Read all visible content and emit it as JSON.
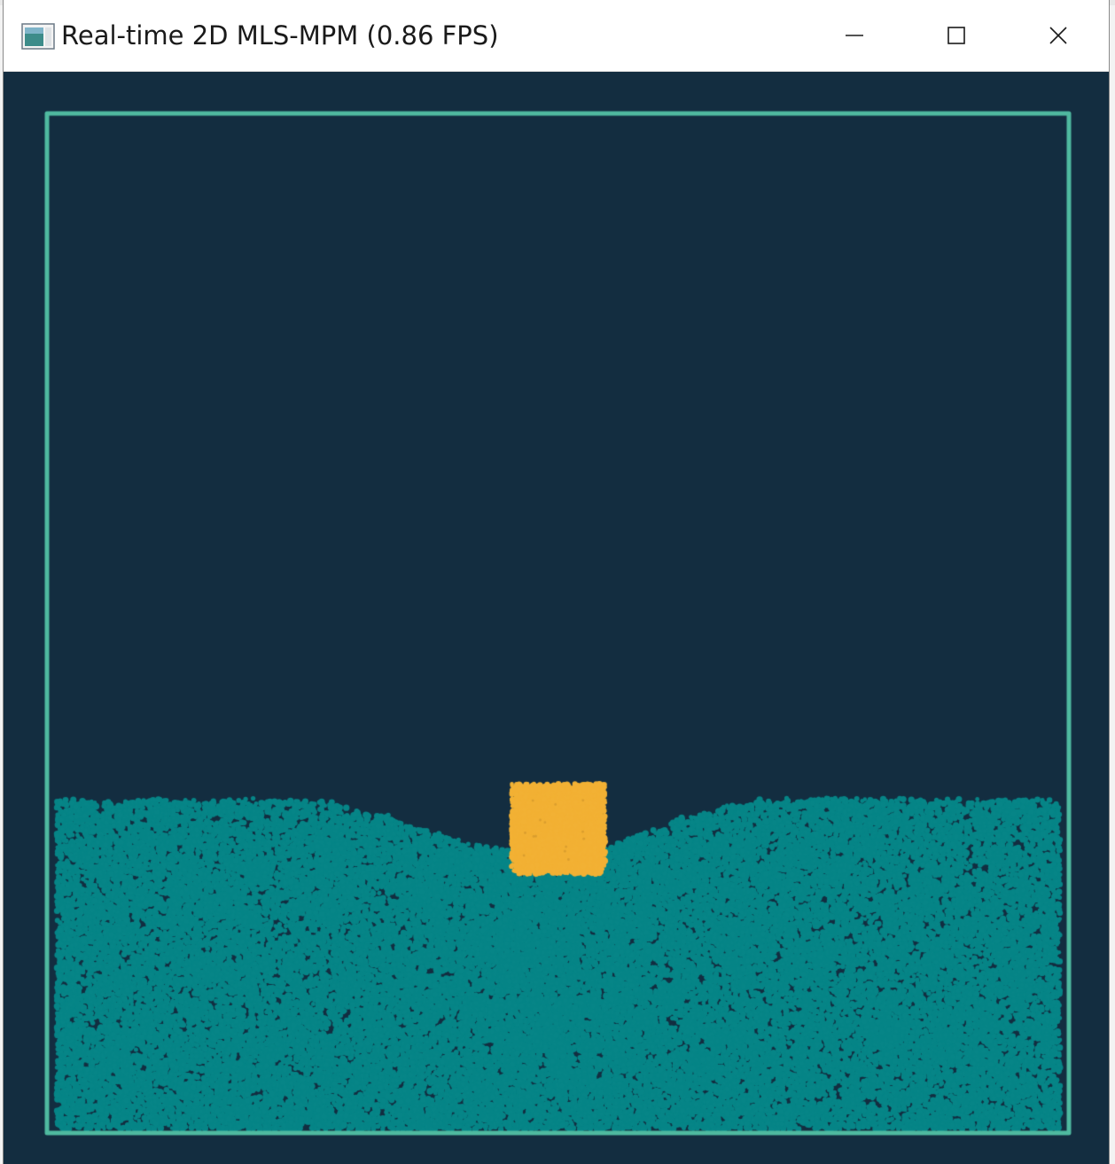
{
  "window": {
    "title": "Real-time 2D MLS-MPM (0.86 FPS)",
    "icons": {
      "app": "app-window-icon",
      "minimize": "minimize-icon",
      "maximize": "maximize-icon",
      "close": "close-icon"
    }
  },
  "colors": {
    "background": "#132d40",
    "boundary": "#4fb99f",
    "fluid_particles": "#068587",
    "rigid_block": "#f2b134"
  }
}
